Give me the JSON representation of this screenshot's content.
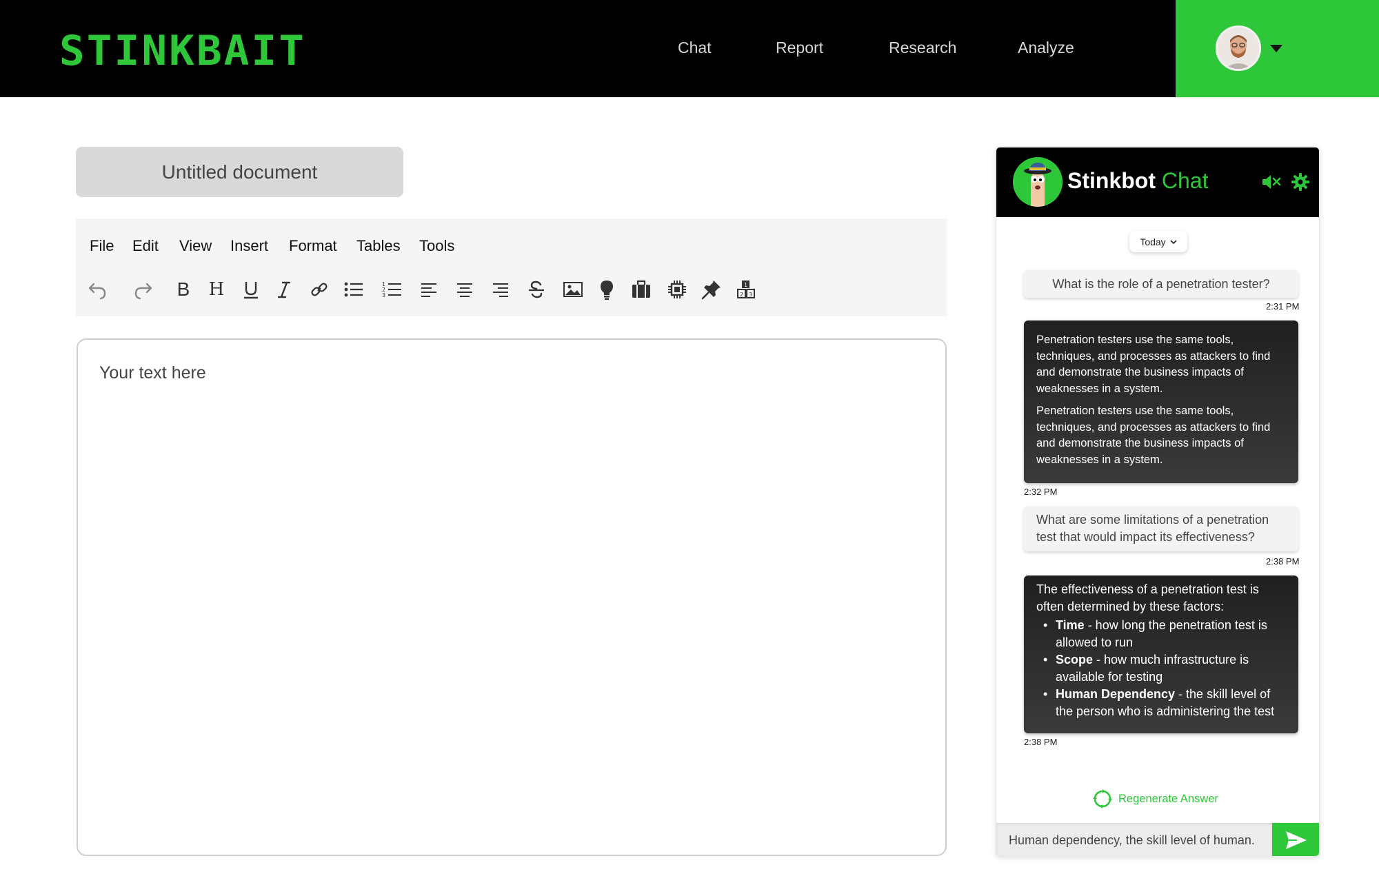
{
  "app": {
    "logo_text": "STINKBAIT",
    "nav": [
      "Chat",
      "Report",
      "Research",
      "Analyze"
    ]
  },
  "document": {
    "title": "Untitled document",
    "menu": [
      "File",
      "Edit",
      "View",
      "Insert",
      "Format",
      "Tables",
      "Tools"
    ],
    "toolbar_icons": [
      "undo-icon",
      "redo-icon",
      "bold-icon",
      "heading-icon",
      "underline-icon",
      "italic-icon",
      "link-icon",
      "bulleted-list-icon",
      "numbered-list-icon",
      "align-left-icon",
      "align-center-icon",
      "align-right-icon",
      "strikethrough-icon",
      "image-icon",
      "lightbulb-icon",
      "briefcase-icon",
      "chip-icon",
      "pin-icon",
      "blocks-icon"
    ],
    "toolbar_text": {
      "bold": "B",
      "heading": "H"
    },
    "editor_placeholder": "Your text here"
  },
  "chat": {
    "title": "Stinkbot",
    "title_accent": "Chat",
    "date_filter": "Today",
    "messages": [
      {
        "role": "user",
        "text": "What is the role of a penetration tester?",
        "time": "2:31 PM"
      },
      {
        "role": "bot",
        "paragraphs": [
          "Penetration testers use the same tools, techniques, and processes as attackers to find and demonstrate the business impacts of weaknesses in a system.",
          "Penetration testers use the same tools, techniques, and processes as attackers to find and demonstrate the business  impacts of weaknesses in a system."
        ],
        "time": "2:32 PM"
      },
      {
        "role": "user",
        "text": "What are some limitations of a penetration test that would impact its effectiveness?",
        "time": "2:38 PM"
      },
      {
        "role": "bot",
        "intro": "The effectiveness of a penetration test is often determined by these factors:",
        "factors": [
          {
            "term": "Time",
            "desc": " - how long the penetration test is allowed to run"
          },
          {
            "term": "Scope",
            "desc": " - how much infrastructure is available for testing"
          },
          {
            "term": "Human Dependency",
            "desc": " - the skill level of the person who is administering the test"
          }
        ],
        "time": "2:38 PM"
      }
    ],
    "regenerate_label": "Regenerate Answer",
    "input_value": "Human dependency, the skill level of human."
  },
  "colors": {
    "brand_green": "#2fc73a",
    "header_bg": "#000000",
    "toolbar_bg": "#f5f5f5"
  }
}
